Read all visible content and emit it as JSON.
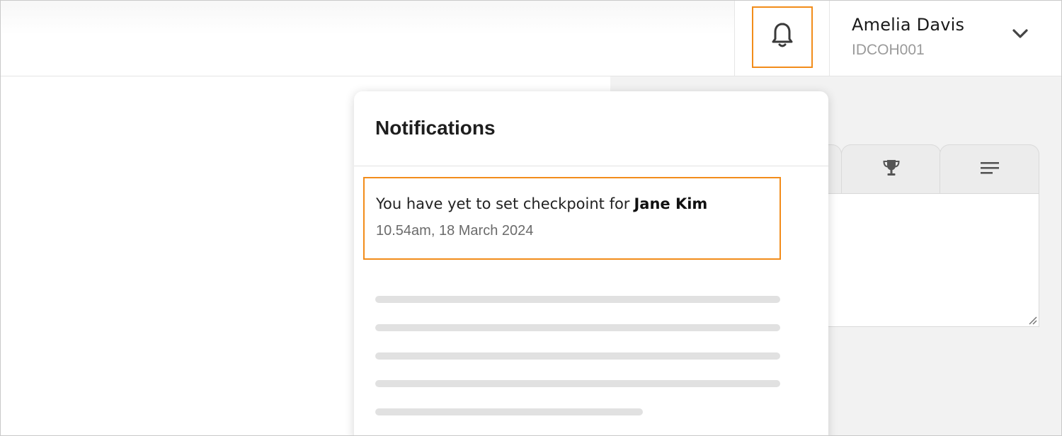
{
  "header": {
    "user": {
      "name": "Amelia Davis",
      "id": "IDCOH001"
    },
    "icons": {
      "notifications": "bell-icon",
      "user_menu": "chevron-down-icon"
    }
  },
  "notifications": {
    "title": "Notifications",
    "items": [
      {
        "message": "You have yet to set checkpoint for",
        "subject": "Jane Kim",
        "timestamp": "10.54am, 18 March 2024"
      }
    ]
  },
  "background_tabs": {
    "icons": [
      "trophy-icon",
      "lines-icon"
    ]
  },
  "colors": {
    "highlight": "#f28c1a",
    "panel_bg": "#f2f2f2"
  }
}
